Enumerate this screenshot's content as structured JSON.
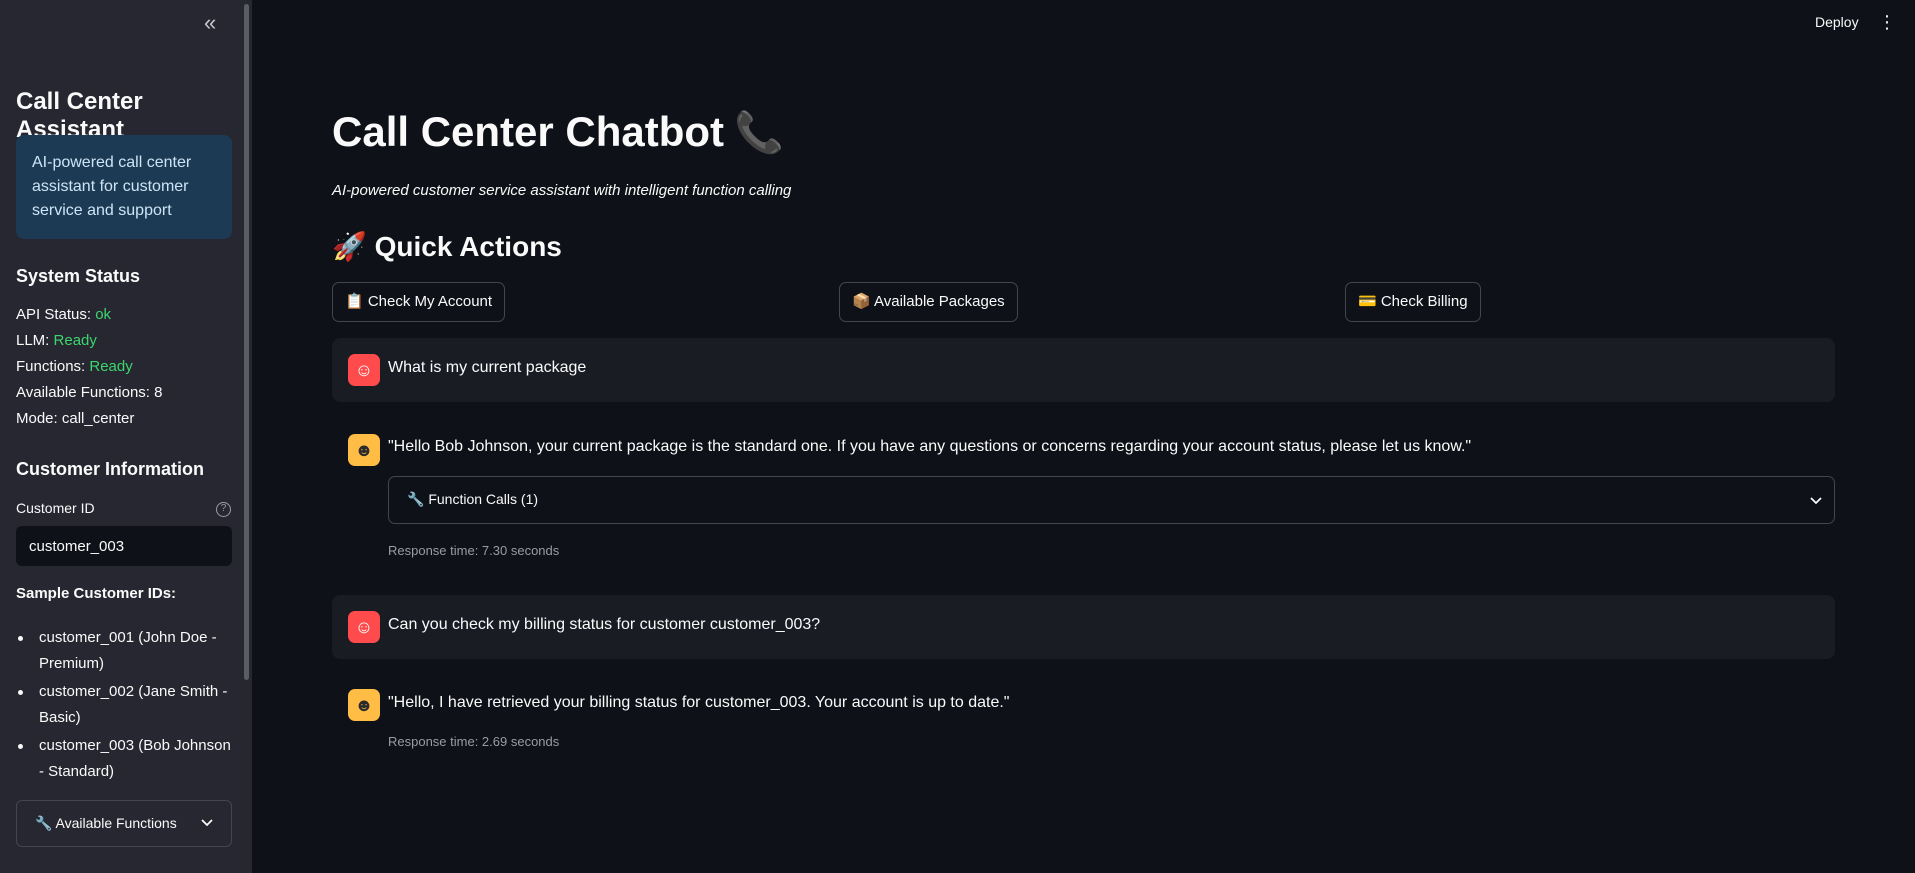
{
  "sidebar": {
    "collapse_glyph": "«",
    "title": "Call Center Assistant",
    "info": "AI-powered call center assistant for customer service and support",
    "system_status_title": "System Status",
    "api_status_label": "API Status:",
    "api_status_value": "ok",
    "llm_label": "LLM:",
    "llm_value": "Ready",
    "functions_label": "Functions:",
    "functions_value": "Ready",
    "available_functions_line": "Available Functions: 8",
    "mode_line": "Mode: call_center",
    "customer_info_title": "Customer Information",
    "customer_id_label": "Customer ID",
    "customer_id_value": "customer_003",
    "sample_title": "Sample Customer IDs:",
    "samples": [
      "customer_001 (John Doe - Premium)",
      "customer_002 (Jane Smith - Basic)",
      "customer_003 (Bob Johnson - Standard)"
    ],
    "available_functions_expander": "🔧 Available Functions",
    "status_color": "#3dd56d"
  },
  "header": {
    "deploy_label": "Deploy",
    "menu_glyph": "⋮"
  },
  "main": {
    "title": "Call Center Chatbot",
    "title_emoji": "📞",
    "subtitle": "AI-powered customer service assistant with intelligent function calling",
    "quick_actions_title": "🚀 Quick Actions",
    "buttons": {
      "check_account": "📋 Check My Account",
      "available_packages": "📦 Available Packages",
      "check_billing": "💳 Check Billing"
    },
    "messages": [
      {
        "role": "user",
        "text": "What is my current package"
      },
      {
        "role": "assistant",
        "text": "\"Hello Bob Johnson, your current package is the standard one. If you have any questions or concerns regarding your account status, please let us know.\"",
        "function_calls": "🔧 Function Calls (1)",
        "response_time": "Response time: 7.30 seconds"
      },
      {
        "role": "user",
        "text": "Can you check my billing status for customer customer_003?"
      },
      {
        "role": "assistant",
        "text": "\"Hello, I have retrieved your billing status for customer_003. Your account is up to date.\"",
        "response_time": "Response time: 2.69 seconds"
      }
    ]
  },
  "icons": {
    "user_avatar": "user-face-icon",
    "bot_avatar": "robot-face-icon",
    "chevron": "chevron-down-icon"
  }
}
